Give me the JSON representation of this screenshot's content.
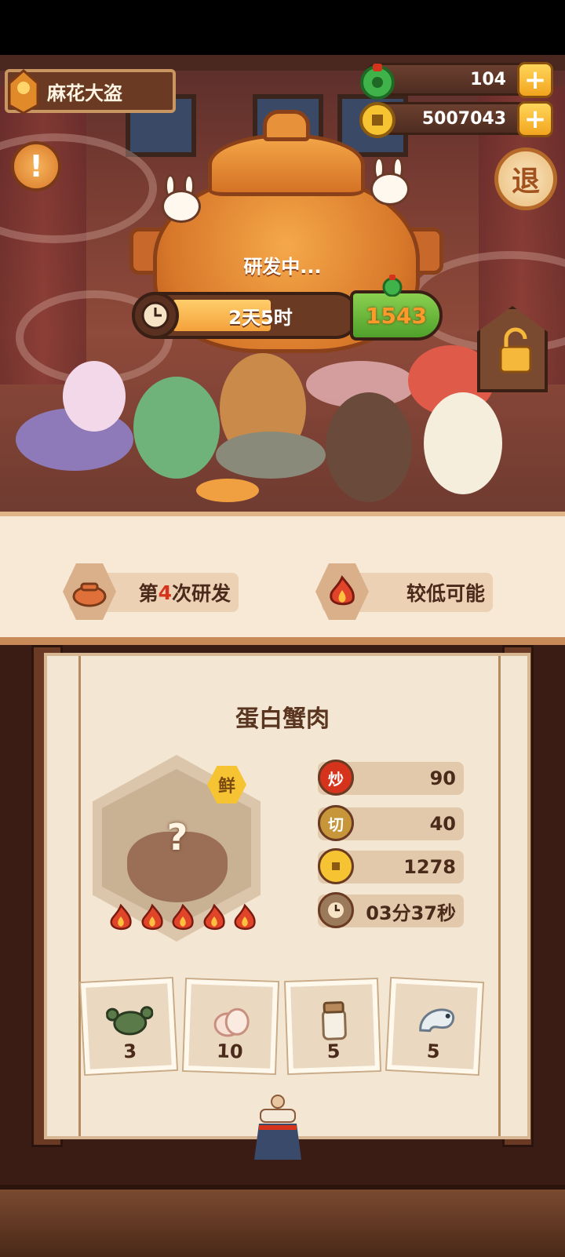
{
  "player": {
    "name": "麻花大盗",
    "avatar_icon": "thief-avatar-icon"
  },
  "currency": {
    "jade": {
      "value": "104",
      "icon": "jade-gem-icon"
    },
    "coins": {
      "value": "5007043",
      "icon": "coin-icon"
    }
  },
  "buttons": {
    "exit_label": "退",
    "alert_label": "!"
  },
  "research": {
    "status": "研发中...",
    "time_remaining": "2天5时",
    "progress": 0.55,
    "speedup_cost": "1543"
  },
  "info": {
    "attempt_prefix": "第",
    "attempt_number": "4",
    "attempt_suffix": "次研发",
    "chance": "较低可能"
  },
  "dish": {
    "name": "蛋白蟹肉",
    "badge": "鲜",
    "unknown_mark": "?",
    "difficulty_flames": 5,
    "stats": {
      "stir_fry": {
        "label": "炒",
        "value": "90"
      },
      "cut": {
        "label": "切",
        "value": "40"
      },
      "price": {
        "icon": "coin-icon",
        "value": "1278"
      },
      "time": {
        "icon": "clock-icon",
        "value": "03分37秒"
      }
    },
    "ingredients": [
      {
        "icon": "crab-icon",
        "count": "3"
      },
      {
        "icon": "egg-icon",
        "count": "10"
      },
      {
        "icon": "jar-icon",
        "count": "5"
      },
      {
        "icon": "shrimp-icon",
        "count": "5"
      }
    ]
  },
  "colors": {
    "accent_orange": "#f4a13b",
    "speed_green": "#4fa02a",
    "highlight_red": "#d6331d"
  }
}
